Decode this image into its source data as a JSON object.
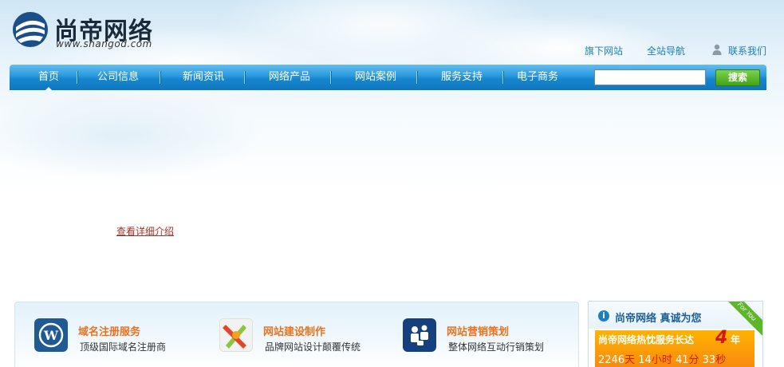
{
  "brand": {
    "name": "尚帝网络",
    "url_text": "www.shangod.com",
    "colors": {
      "nav_blue": "#2a98dd",
      "link_blue": "#1a7fb8",
      "orange": "#e8731f",
      "green": "#3fa319"
    }
  },
  "top_links": {
    "sub_sites": "旗下网站",
    "site_nav": "全站导航",
    "contact": "联系我们",
    "contact_icon": "user-icon"
  },
  "nav": {
    "items": [
      "首页",
      "公司信息",
      "新闻资讯",
      "网络产品",
      "网站案例",
      "服务支持",
      "电子商务"
    ],
    "active_index": 0,
    "search_placeholder": "",
    "search_button": "搜索"
  },
  "main": {
    "detail_link": "查看详细介绍"
  },
  "services": [
    {
      "title": "域名注册服务",
      "desc": "顶级国际域名注册商",
      "icon": "wordpress-icon"
    },
    {
      "title": "网站建设制作",
      "desc": "品牌网站设计颠覆传统",
      "icon": "tools-icon"
    },
    {
      "title": "网站营销策划",
      "desc": "整体网络互动行销策划",
      "icon": "people-icon"
    }
  ],
  "sidebox": {
    "title": "尚帝网络 真诚为您",
    "ribbon": "For You",
    "counter_prefix": "尚帝网络热忱服务长达",
    "years": "4",
    "years_unit": "年",
    "days": "2246",
    "days_unit": "天",
    "hours": "14",
    "hours_unit": "小时",
    "minutes": "41",
    "minutes_unit": "分",
    "seconds": "33",
    "seconds_unit": "秒"
  }
}
